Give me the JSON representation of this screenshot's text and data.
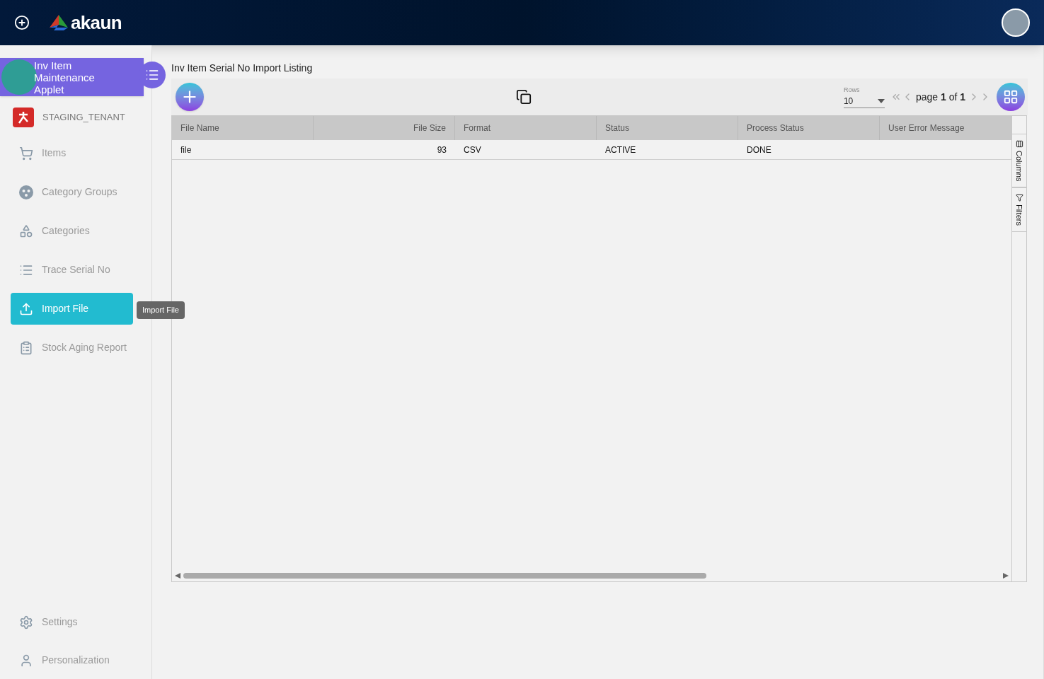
{
  "header": {
    "logo": "akaun"
  },
  "applet": {
    "title": "Inv Item Maintenance Applet"
  },
  "tenant": {
    "name": "STAGING_TENANT"
  },
  "sidebar": {
    "items": [
      {
        "label": "Items",
        "selected": false
      },
      {
        "label": "Category Groups",
        "selected": false
      },
      {
        "label": "Categories",
        "selected": false
      },
      {
        "label": "Trace Serial No",
        "selected": false
      },
      {
        "label": "Import File",
        "selected": true
      },
      {
        "label": "Stock Aging Report",
        "selected": false
      }
    ],
    "tooltip": "Import File",
    "bottom_items": [
      {
        "label": "Settings"
      },
      {
        "label": "Personalization"
      }
    ]
  },
  "page": {
    "title": "Inv Item Serial No Import Listing"
  },
  "pagination": {
    "rows_label": "Rows",
    "rows_value": "10",
    "page_word": "page",
    "page": "1",
    "of_word": "of",
    "total": "1"
  },
  "table": {
    "columns": [
      {
        "label": "File Name"
      },
      {
        "label": "File Size"
      },
      {
        "label": "Format"
      },
      {
        "label": "Status"
      },
      {
        "label": "Process Status"
      },
      {
        "label": "User Error Message"
      }
    ],
    "rows": [
      [
        "file",
        "93",
        "CSV",
        "ACTIVE",
        "DONE",
        ""
      ]
    ]
  },
  "side_tabs": [
    "Columns",
    "Filters"
  ]
}
